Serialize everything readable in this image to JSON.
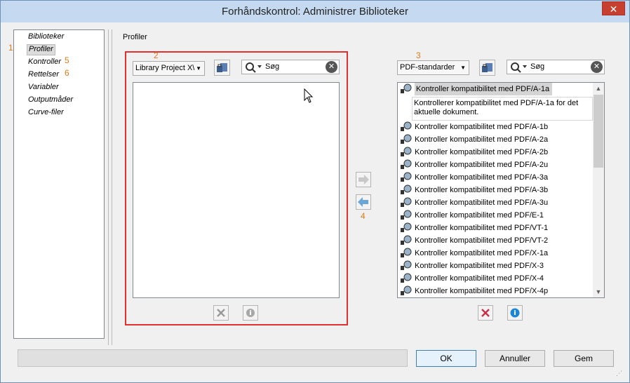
{
  "window": {
    "title": "Forhåndskontrol: Administrer Biblioteker",
    "close_label": "✕"
  },
  "nav": {
    "items": [
      {
        "label": "Biblioteker"
      },
      {
        "label": "Profiler"
      },
      {
        "label": "Kontroller"
      },
      {
        "label": "Rettelser"
      },
      {
        "label": "Variabler"
      },
      {
        "label": "Outputmåder"
      },
      {
        "label": "Curve-filer"
      }
    ],
    "selected": "Profiler"
  },
  "annotations": [
    "1",
    "2",
    "3",
    "4",
    "5",
    "6"
  ],
  "section_label": "Profiler",
  "left_pane": {
    "library_select": "Library Project X\\",
    "search_placeholder": "Søg"
  },
  "right_pane": {
    "standards_select": "PDF-standarder",
    "search_placeholder": "Søg",
    "items": [
      {
        "label": "Kontroller kompatibilitet med PDF/A-1a"
      },
      {
        "label": "Kontroller kompatibilitet med PDF/A-1b"
      },
      {
        "label": "Kontroller kompatibilitet med PDF/A-2a"
      },
      {
        "label": "Kontroller kompatibilitet med PDF/A-2b"
      },
      {
        "label": "Kontroller kompatibilitet med PDF/A-2u"
      },
      {
        "label": "Kontroller kompatibilitet med PDF/A-3a"
      },
      {
        "label": "Kontroller kompatibilitet med PDF/A-3b"
      },
      {
        "label": "Kontroller kompatibilitet med PDF/A-3u"
      },
      {
        "label": "Kontroller kompatibilitet med PDF/E-1"
      },
      {
        "label": "Kontroller kompatibilitet med PDF/VT-1"
      },
      {
        "label": "Kontroller kompatibilitet med PDF/VT-2"
      },
      {
        "label": "Kontroller kompatibilitet med PDF/X-1a"
      },
      {
        "label": "Kontroller kompatibilitet med PDF/X-3"
      },
      {
        "label": "Kontroller kompatibilitet med PDF/X-4"
      },
      {
        "label": "Kontroller kompatibilitet med PDF/X-4p"
      }
    ],
    "selected_description": "Kontrollerer kompatibilitet med PDF/A-1a for det aktuelle dokument."
  },
  "buttons": {
    "ok": "OK",
    "cancel": "Annuller",
    "save": "Gem"
  },
  "colors": {
    "highlight_frame": "#e03030",
    "annotation": "#e07a1a"
  }
}
